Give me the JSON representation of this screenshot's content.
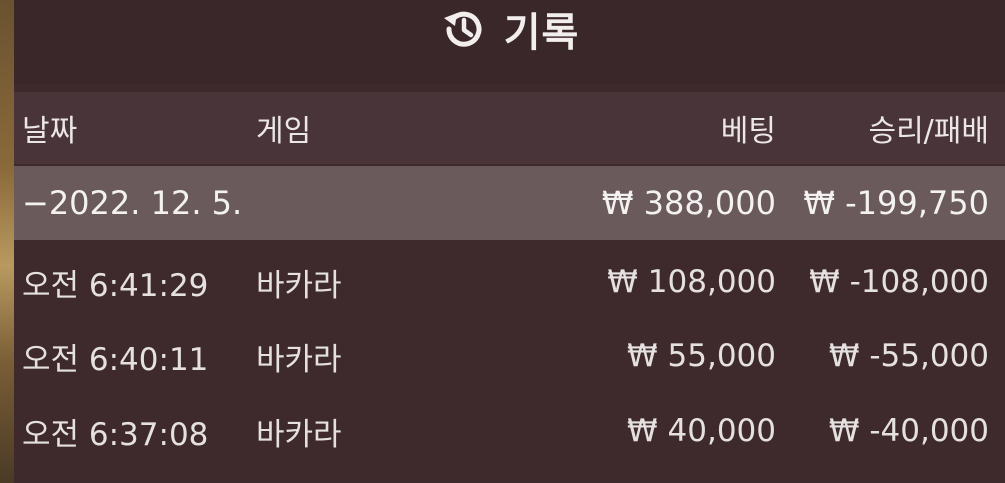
{
  "title": {
    "icon": "history-icon",
    "text": "기록"
  },
  "columns": {
    "date": "날짜",
    "game": "게임",
    "bet": "베팅",
    "result": "승리/패배"
  },
  "summary": {
    "date": "−2022. 12. 5.",
    "bet": "₩ 388,000",
    "result": "₩ -199,750"
  },
  "rows": [
    {
      "time": "오전 6:41:29",
      "game": "바카라",
      "bet": "₩ 108,000",
      "result": "₩ -108,000"
    },
    {
      "time": "오전 6:40:11",
      "game": "바카라",
      "bet": "₩ 55,000",
      "result": "₩ -55,000"
    },
    {
      "time": "오전 6:37:08",
      "game": "바카라",
      "bet": "₩ 40,000",
      "result": "₩ -40,000"
    }
  ]
}
